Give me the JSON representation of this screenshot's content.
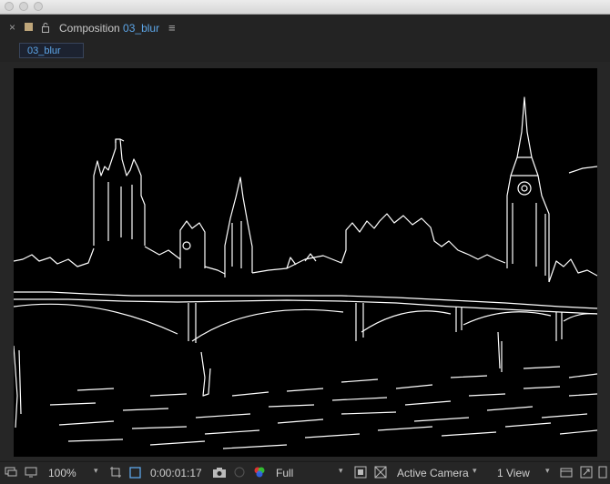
{
  "window": {
    "buttons": [
      "close",
      "minimize",
      "zoom"
    ]
  },
  "panel": {
    "close": "×",
    "title_prefix": "Composition",
    "title_name": "03_blur",
    "menu": "≡",
    "swatch_color": "#bfa67a",
    "accent_color": "#5da6e8"
  },
  "breadcrumb": {
    "tab": "03_blur"
  },
  "viewer": {
    "content": "edge-detected image of Westminster Palace, Big Ben and Westminster Bridge on black background"
  },
  "toolbar": {
    "zoom": "100%",
    "timecode": "0:00:01:17",
    "resolution": "Full",
    "camera": "Active Camera",
    "views": "1 View"
  },
  "icons": [
    "composition-swatch-icon",
    "lock-icon",
    "panel-menu-icon",
    "monitor-icon",
    "display-icon",
    "region-of-interest-icon",
    "transparency-grid-icon",
    "camera-snapshot-icon",
    "show-snapshot-icon",
    "color-channels-icon",
    "fast-previews-icon",
    "toggle-grid-icon",
    "toggle-mask-icon",
    "reset-exposure-icon",
    "view-layout-icon",
    "flowchart-icon"
  ]
}
